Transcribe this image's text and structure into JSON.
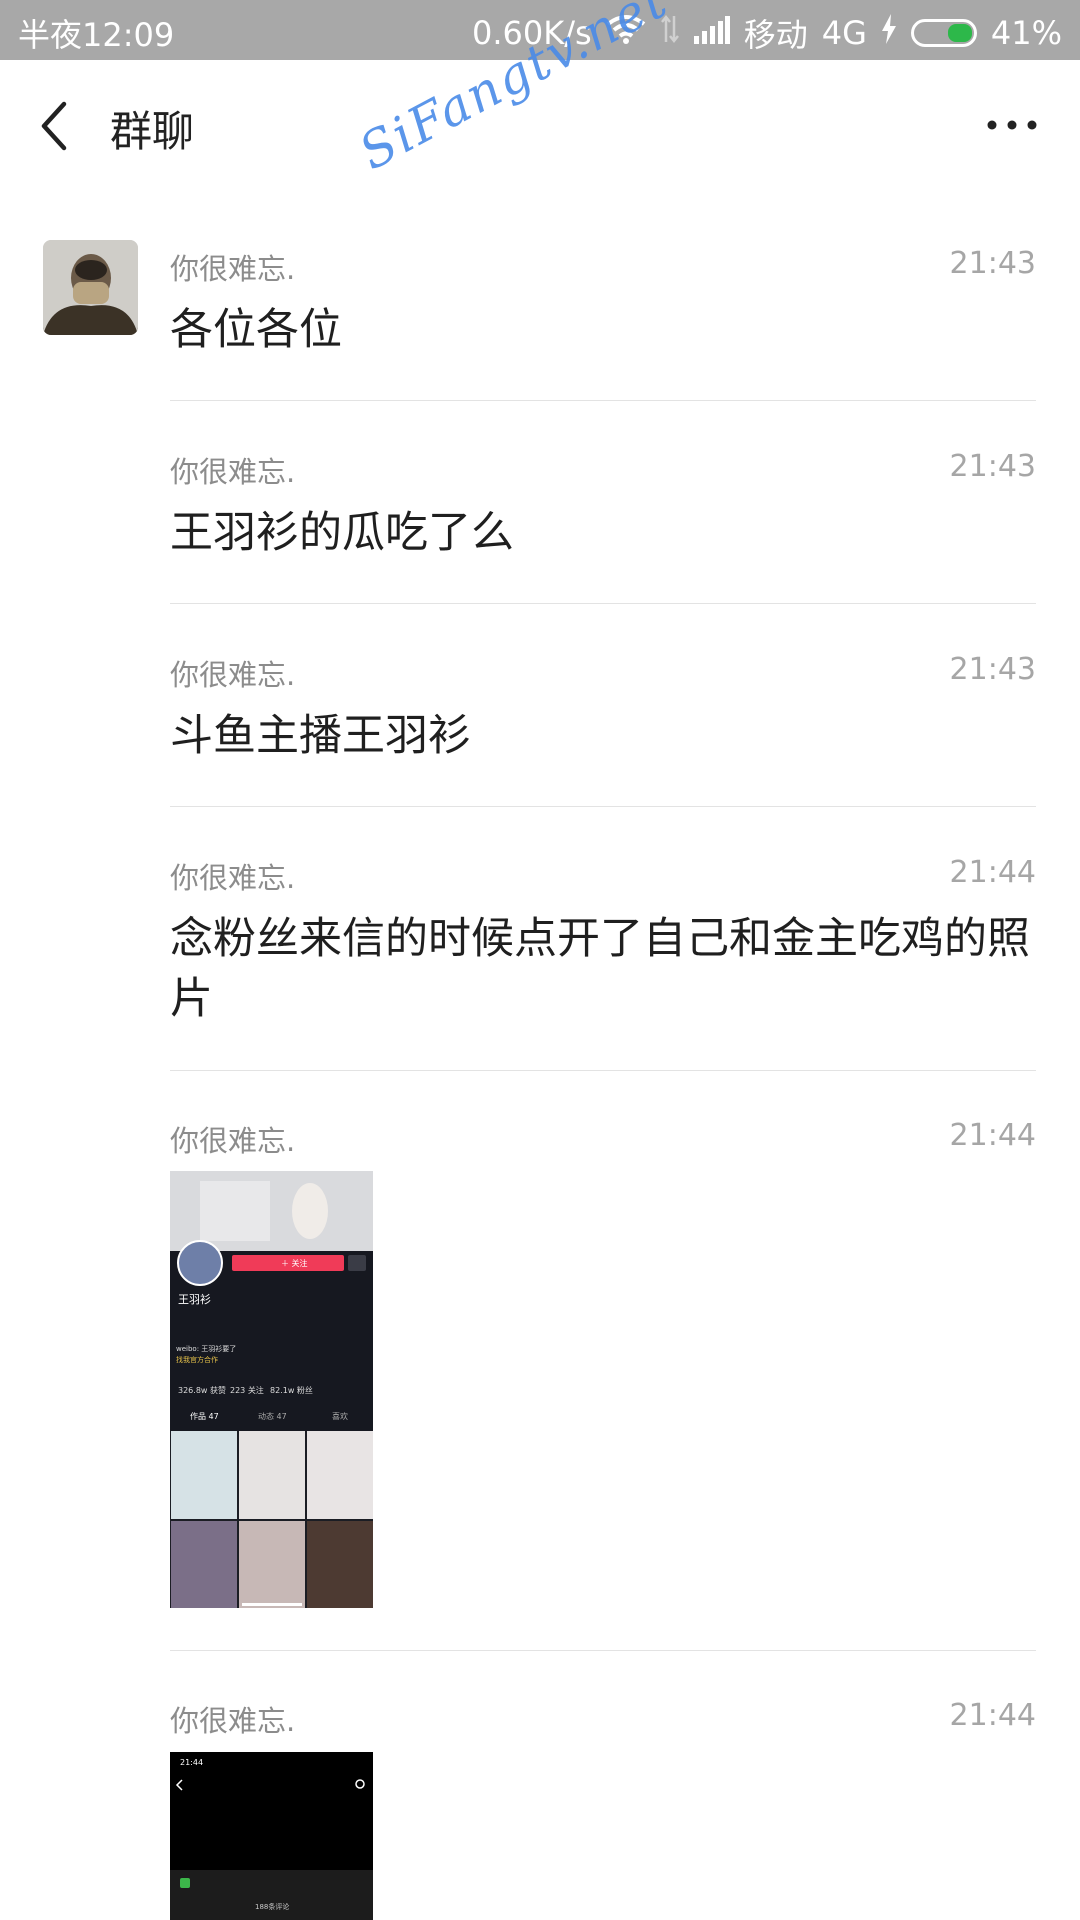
{
  "status_bar": {
    "time": "半夜12:09",
    "net_speed": "0.60K/s",
    "carrier": "移动",
    "network": "4G",
    "battery": "41%",
    "battery_level": 0.41
  },
  "header": {
    "title": "群聊"
  },
  "watermark": "SiFangtv.net",
  "messages": [
    {
      "sender": "你很难忘.",
      "time": "21:43",
      "text": "各位各位"
    },
    {
      "sender": "你很难忘.",
      "time": "21:43",
      "text": "王羽衫的瓜吃了么"
    },
    {
      "sender": "你很难忘.",
      "time": "21:43",
      "text": "斗鱼主播王羽衫"
    },
    {
      "sender": "你很难忘.",
      "time": "21:44",
      "text": "念粉丝来信的时候点开了自己和金主吃鸡的照片"
    },
    {
      "sender": "你很难忘.",
      "time": "21:44",
      "image": "profile-screenshot"
    },
    {
      "sender": "你很难忘.",
      "time": "21:44",
      "image": "video-screenshot"
    }
  ],
  "thumb1": {
    "name": "王羽衫",
    "follow": "＋ 关注",
    "stat1": "326.8w 获赞",
    "stat2": "223 关注",
    "stat3": "82.1w 粉丝",
    "tab1": "作品 47",
    "tab2": "动态 47",
    "tab3": "喜欢",
    "bio": "weibo: 王羽衫要了",
    "cta": "找我官方合作"
  },
  "thumb2": {
    "time": "21:44",
    "comments": "188条评论"
  }
}
